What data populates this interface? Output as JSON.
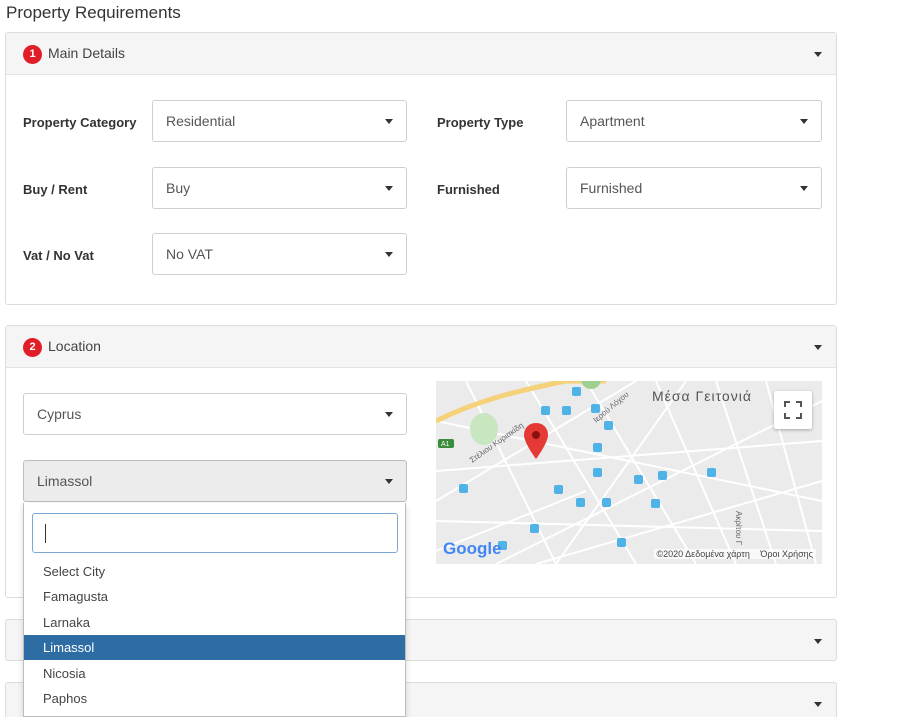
{
  "page": {
    "title": "Property Requirements"
  },
  "main_details": {
    "number": "1",
    "title": "Main Details",
    "fields": {
      "property_category": {
        "label": "Property Category",
        "value": "Residential"
      },
      "property_type": {
        "label": "Property Type",
        "value": "Apartment"
      },
      "buy_rent": {
        "label": "Buy / Rent",
        "value": "Buy"
      },
      "furnished": {
        "label": "Furnished",
        "value": "Furnished"
      },
      "vat": {
        "label": "Vat / No Vat",
        "value": "No VAT"
      }
    }
  },
  "location": {
    "number": "2",
    "title": "Location",
    "country": "Cyprus",
    "city": "Limassol",
    "city_dropdown": {
      "search_value": "",
      "options": [
        "Select City",
        "Famagusta",
        "Larnaka",
        "Limassol",
        "Nicosia",
        "Paphos"
      ],
      "selected": "Limassol"
    },
    "map": {
      "area_label": "Μέσα Γειτονιά",
      "logo": "Google",
      "copyright": "©2020 Δεδομένα χάρτη",
      "terms": "Όροι Χρήσης",
      "marker_icon": "map-pin-icon",
      "fullscreen_icon": "fullscreen-icon"
    }
  },
  "colors": {
    "badge": "#e01e27",
    "selected_option": "#2e6da4",
    "panel_header": "#f5f5f5"
  }
}
